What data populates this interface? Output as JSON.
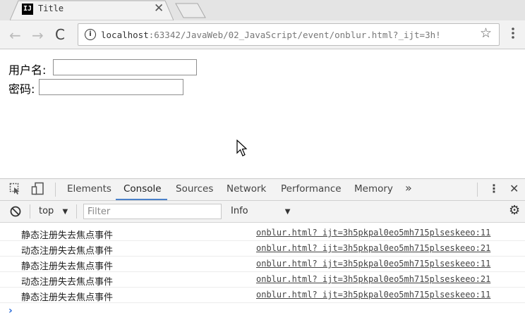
{
  "tab": {
    "title": "Title",
    "favicon_text": "IJ",
    "close_glyph": "✕"
  },
  "toolbar": {
    "back_glyph": "←",
    "forward_glyph": "→",
    "reload_glyph": "C",
    "info_glyph": "i",
    "url_host": "localhost",
    "url_rest": ":63342/JavaWeb/02_JavaScript/event/onblur.html?_ijt=3h!",
    "star_glyph": "☆",
    "menu_glyph": "⋮"
  },
  "form": {
    "username_label": "用户名:",
    "password_label": "密码:"
  },
  "devtools": {
    "inspect_icon": "inspect-element-icon",
    "device_icon": "device-toggle-icon",
    "tabs": [
      "Elements",
      "Console",
      "Sources",
      "Network",
      "Performance",
      "Memory"
    ],
    "more_glyph": "»",
    "menu_glyph": "⋮",
    "close_glyph": "✕",
    "context": "top",
    "context_arrow": "▼",
    "filter_placeholder": "Filter",
    "level": "Info",
    "level_arrow": "▼",
    "settings_glyph": "⚙",
    "accent": "#4a80c9"
  },
  "console": {
    "rows": [
      {
        "message": "静态注册失去焦点事件",
        "source": "onblur.html? ijt=3h5pkpal0eo5mh715plseskeeo:11"
      },
      {
        "message": "动态注册失去焦点事件",
        "source": "onblur.html? ijt=3h5pkpal0eo5mh715plseskeeo:21"
      },
      {
        "message": "静态注册失去焦点事件",
        "source": "onblur.html? ijt=3h5pkpal0eo5mh715plseskeeo:11"
      },
      {
        "message": "动态注册失去焦点事件",
        "source": "onblur.html? ijt=3h5pkpal0eo5mh715plseskeeo:21"
      },
      {
        "message": "静态注册失去焦点事件",
        "source": "onblur.html? ijt=3h5pkpal0eo5mh715plseskeeo:11"
      }
    ],
    "prompt_glyph": "›"
  }
}
